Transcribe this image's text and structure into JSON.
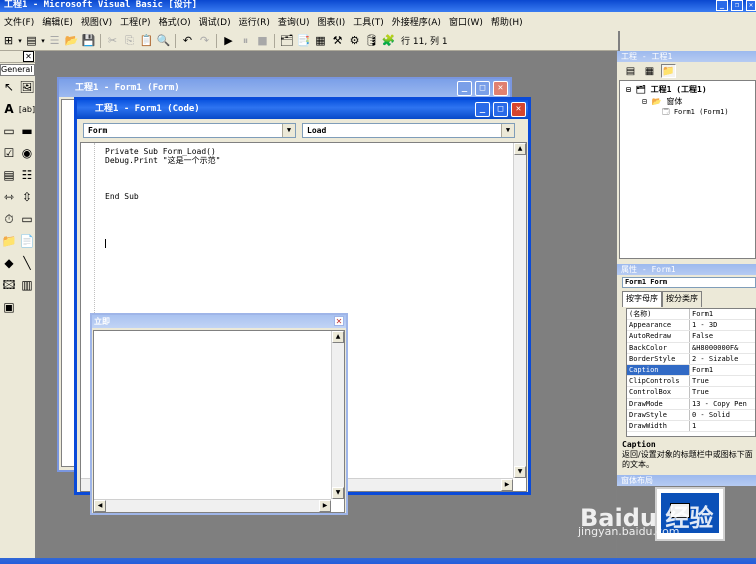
{
  "app": {
    "title": "工程1 - Microsoft Visual Basic [设计]"
  },
  "menu": [
    "文件(F)",
    "编辑(E)",
    "视图(V)",
    "工程(P)",
    "格式(O)",
    "调试(D)",
    "运行(R)",
    "查询(U)",
    "图表(I)",
    "工具(T)",
    "外接程序(A)",
    "窗口(W)",
    "帮助(H)"
  ],
  "toolbar": {
    "position_label": "行 11, 列 1"
  },
  "toolbox": {
    "tab_label": "General"
  },
  "form_window": {
    "title": "工程1 - Form1 (Form)"
  },
  "code_window": {
    "title": "工程1 - Form1 (Code)",
    "object_combo": "Form",
    "procedure_combo": "Load",
    "lines": "Private Sub Form_Load()\nDebug.Print \"这是一个示范\"\n\n\n\nEnd Sub"
  },
  "immediate_window": {
    "title": "立即"
  },
  "project_panel": {
    "title": "工程 - 工程1",
    "root": "工程1 (工程1)",
    "folder": "窗体",
    "item": "Form1 (Form1)"
  },
  "properties_panel": {
    "title": "属性 - Form1",
    "object": "Form1 Form",
    "tabs": [
      "按字母序",
      "按分类序"
    ],
    "rows": [
      {
        "k": "(名称)",
        "v": "Form1"
      },
      {
        "k": "Appearance",
        "v": "1 - 3D"
      },
      {
        "k": "AutoRedraw",
        "v": "False"
      },
      {
        "k": "BackColor",
        "v": "&H8000000F&"
      },
      {
        "k": "BorderStyle",
        "v": "2 - Sizable"
      },
      {
        "k": "Caption",
        "v": "Form1"
      },
      {
        "k": "ClipControls",
        "v": "True"
      },
      {
        "k": "ControlBox",
        "v": "True"
      },
      {
        "k": "DrawMode",
        "v": "13 - Copy Pen"
      },
      {
        "k": "DrawStyle",
        "v": "0 - Solid"
      },
      {
        "k": "DrawWidth",
        "v": "1"
      }
    ],
    "selected_index": 5,
    "desc_title": "Caption",
    "desc_text": "返回/设置对象的标题栏中或图标下面的文本。"
  },
  "layout_panel": {
    "title": "窗体布局"
  },
  "watermark": {
    "text": "Baidu 经验",
    "sub": "jingyan.baidu.com"
  },
  "colors": {
    "titlebar": "#0a54e0",
    "selection": "#316ac5",
    "chrome": "#ece9d8"
  }
}
